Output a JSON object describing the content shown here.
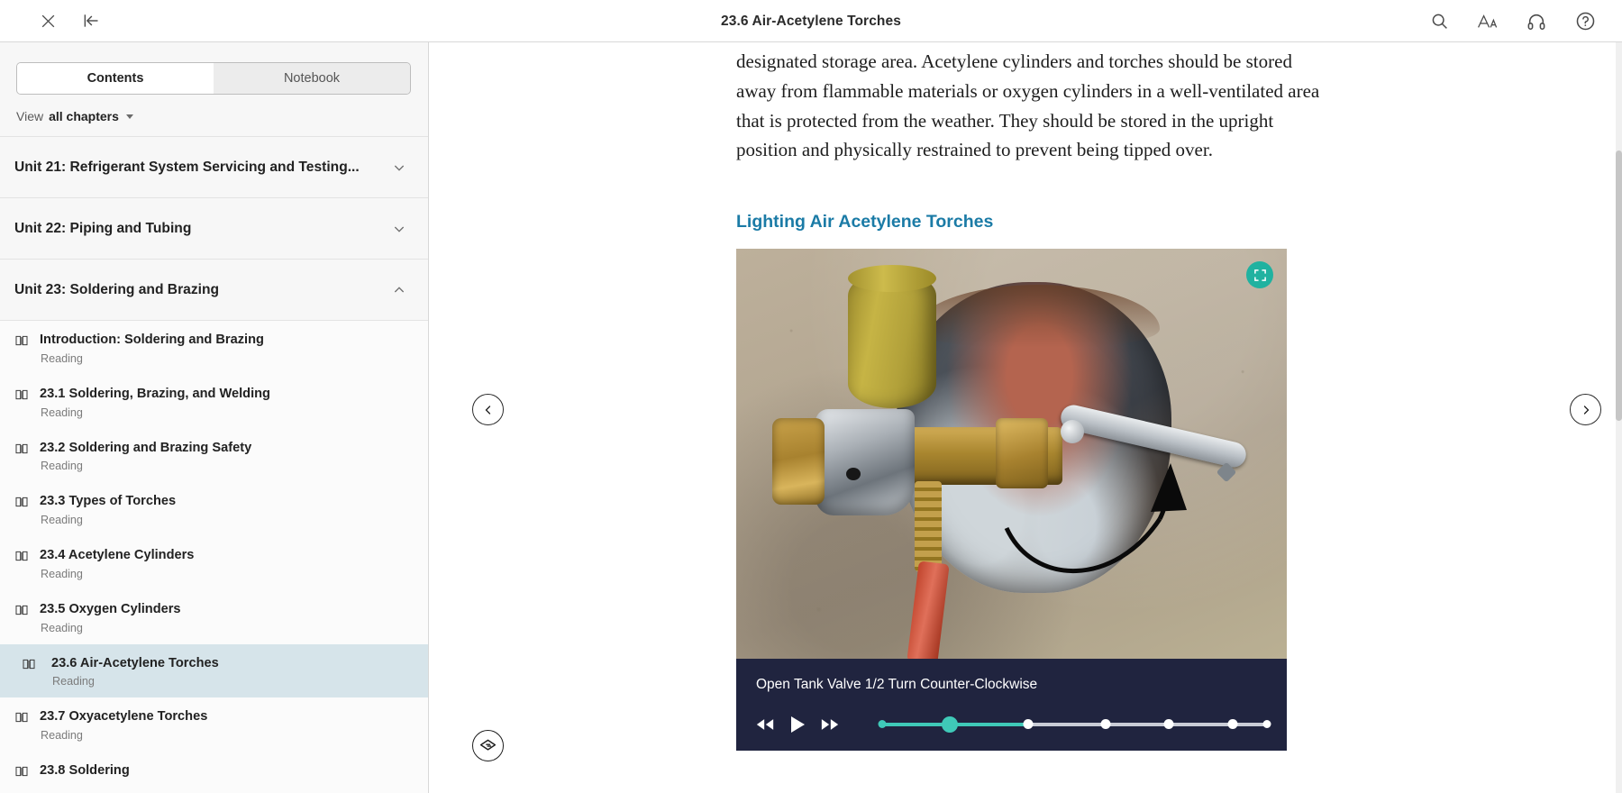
{
  "topbar": {
    "title": "23.6 Air-Acetylene Torches",
    "close_label": "close-icon",
    "collapse_label": "collapse-panel-icon",
    "search_label": "search-icon",
    "textsize_label": "Aa",
    "audio_label": "headphones-icon",
    "help_label": "?"
  },
  "sidebar": {
    "tabs": [
      {
        "label": "Contents",
        "active": true
      },
      {
        "label": "Notebook",
        "active": false
      }
    ],
    "view": {
      "label": "View",
      "value": "all chapters"
    },
    "units": [
      {
        "title": "Unit 21: Refrigerant System Servicing and Testing...",
        "expanded": false
      },
      {
        "title": "Unit 22: Piping and Tubing",
        "expanded": false
      },
      {
        "title": "Unit 23: Soldering and Brazing",
        "expanded": true
      }
    ],
    "lessons": [
      {
        "title": "Introduction: Soldering and Brazing",
        "type": "Reading",
        "selected": false
      },
      {
        "title": "23.1 Soldering, Brazing, and Welding",
        "type": "Reading",
        "selected": false
      },
      {
        "title": "23.2 Soldering and Brazing Safety",
        "type": "Reading",
        "selected": false
      },
      {
        "title": "23.3 Types of Torches",
        "type": "Reading",
        "selected": false
      },
      {
        "title": "23.4 Acetylene Cylinders",
        "type": "Reading",
        "selected": false
      },
      {
        "title": "23.5 Oxygen Cylinders",
        "type": "Reading",
        "selected": false
      },
      {
        "title": "23.6 Air-Acetylene Torches",
        "type": "Reading",
        "selected": true
      },
      {
        "title": "23.7 Oxyacetylene Torches",
        "type": "Reading",
        "selected": false
      },
      {
        "title": "23.8 Soldering",
        "type": "Reading",
        "selected": false
      }
    ]
  },
  "content": {
    "paragraph": "designated storage area. Acetylene cylinders and torches should be stored away from flammable materials or oxygen cylinders in a well-ventilated area that is protected from the weather. They should be stored in the upright position and physically restrained to prevent being tipped over.",
    "section_heading": "Lighting Air Acetylene Torches",
    "image_alt": "air-acetylene-tank-valve-photo",
    "expand_icon": "fullscreen-expand-icon"
  },
  "player": {
    "caption": "Open Tank Valve 1/2 Turn Counter-Clockwise",
    "rewind_label": "rewind-icon",
    "play_label": "play-icon",
    "forward_label": "fast-forward-icon",
    "steps": 6,
    "current_step": 2,
    "progress_percent": 38
  },
  "nav": {
    "prev_label": "‹",
    "next_label": "›",
    "flashcards_label": "flashcards-icon"
  },
  "colors": {
    "accent_teal": "#20b2a0",
    "heading_blue": "#1b7ba6",
    "selected_row": "#d6e4ea",
    "player_bg": "#20243f",
    "progress_teal": "#3fc9b8"
  }
}
